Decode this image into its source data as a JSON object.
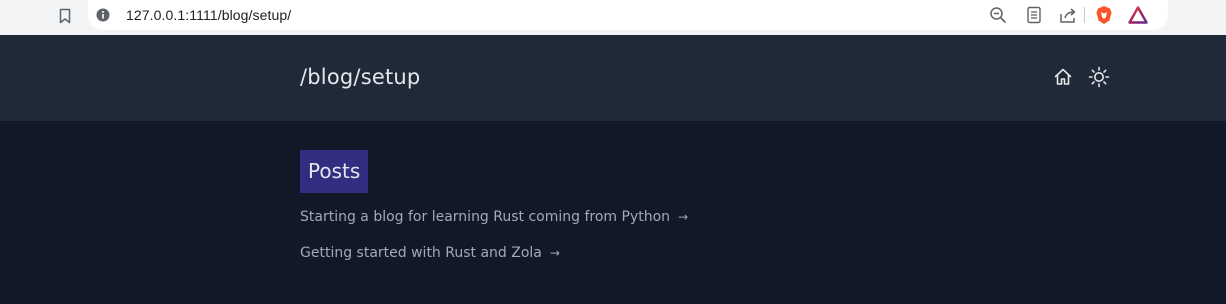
{
  "browser": {
    "url": "127.0.0.1:1111/blog/setup/",
    "toolbar_icons": [
      "bookmark-icon",
      "info-icon",
      "zoom-out-icon",
      "reader-mode-icon",
      "share-icon",
      "brave-shields-icon",
      "brave-rewards-icon"
    ]
  },
  "header": {
    "title": "/blog/setup",
    "icons": [
      "home-icon",
      "sun-icon"
    ]
  },
  "main": {
    "section_title": "Posts",
    "posts": [
      {
        "title": "Starting a blog for learning Rust coming from Python",
        "arrow": "→"
      },
      {
        "title": "Getting started with Rust and Zola",
        "arrow": "→"
      }
    ]
  },
  "colors": {
    "header_bg": "#1f2937",
    "page_bg": "#111827",
    "heading_accent": "#312e81",
    "link": "#a3aab6"
  }
}
